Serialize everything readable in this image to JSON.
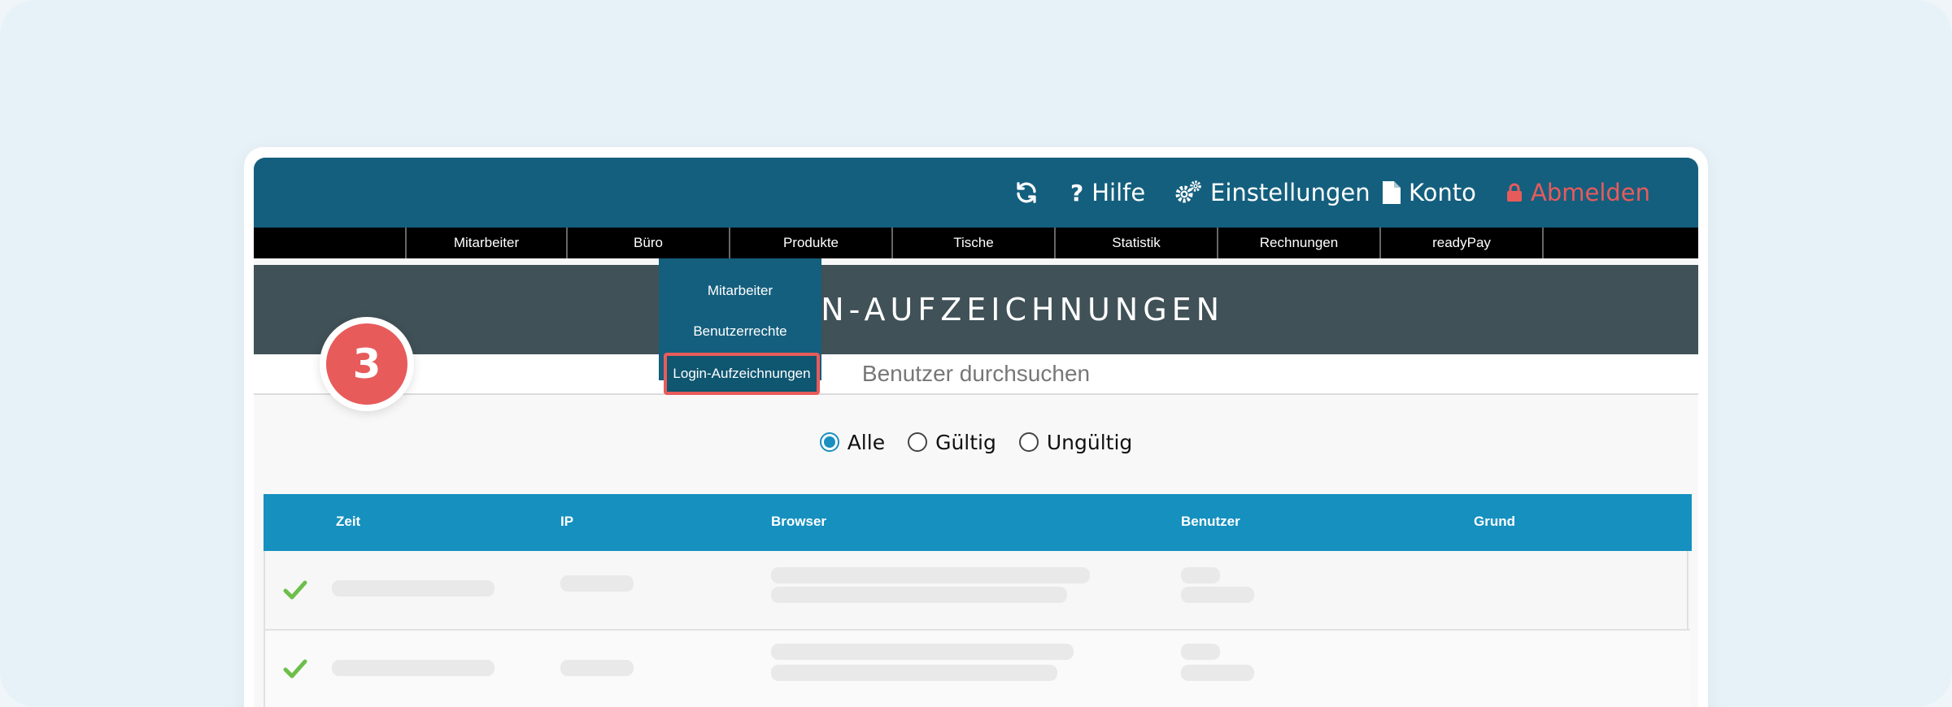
{
  "header": {
    "refresh_icon": "refresh-icon",
    "help_label": "Hilfe",
    "settings_label": "Einstellungen",
    "account_label": "Konto",
    "logout_label": "Abmelden",
    "logout_color": "#e85b5b",
    "brand_color": "#145f7e"
  },
  "nav": {
    "items": [
      "Mitarbeiter",
      "Büro",
      "Produkte",
      "Tische",
      "Statistik",
      "Rechnungen",
      "readyPay"
    ]
  },
  "dropdown": {
    "items": [
      "Mitarbeiter",
      "Benutzerrechte",
      "Login-Aufzeichnungen"
    ],
    "active": "Login-Aufzeichnungen"
  },
  "page": {
    "title": "LOGIN-AUFZEICHNUNGEN",
    "search_label": "Benutzer durchsuchen"
  },
  "filters": {
    "options": [
      "Alle",
      "Gültig",
      "Ungültig"
    ],
    "selected": "Alle"
  },
  "table": {
    "columns": [
      "Zeit",
      "IP",
      "Browser",
      "Benutzer",
      "Grund"
    ],
    "header_color": "#1590bf",
    "rows": [
      {
        "status": "valid",
        "status_icon": "check-icon"
      },
      {
        "status": "valid",
        "status_icon": "check-icon"
      }
    ]
  },
  "annotation": {
    "step_number": "3",
    "color": "#e85b5b"
  }
}
